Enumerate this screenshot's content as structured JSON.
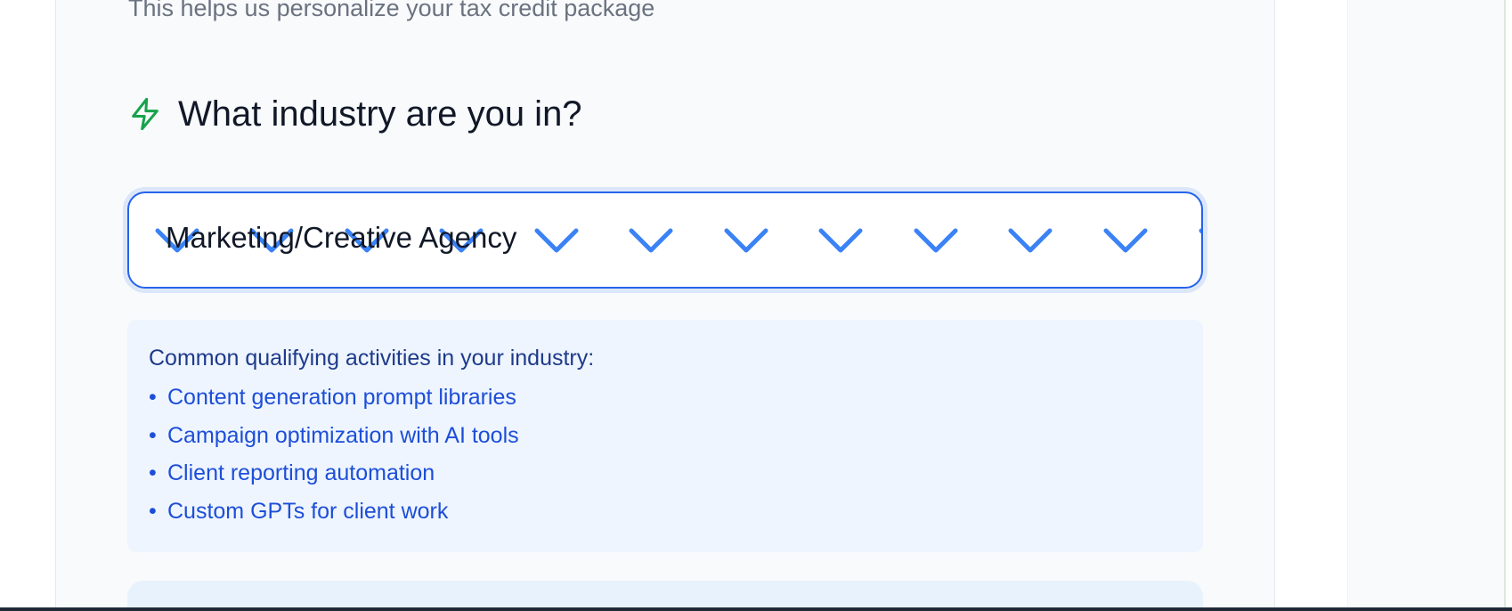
{
  "section": {
    "subtitle": "This helps us personalize your tax credit package"
  },
  "question": {
    "icon": "lightning-icon",
    "title": "What industry are you in?"
  },
  "industry_select": {
    "value": "Marketing/Creative Agency",
    "chevron_icon": "chevron-down-icon"
  },
  "hints": {
    "heading": "Common qualifying activities in your industry:",
    "bullet": "•",
    "items": [
      "Content generation prompt libraries",
      "Campaign optimization with AI tools",
      "Client reporting automation",
      "Custom GPTs for client work"
    ]
  },
  "colors": {
    "accent": "#2563eb",
    "icon_green": "#16a34a",
    "hint_text": "#1d4ed8",
    "hint_heading": "#1e3a8a"
  }
}
